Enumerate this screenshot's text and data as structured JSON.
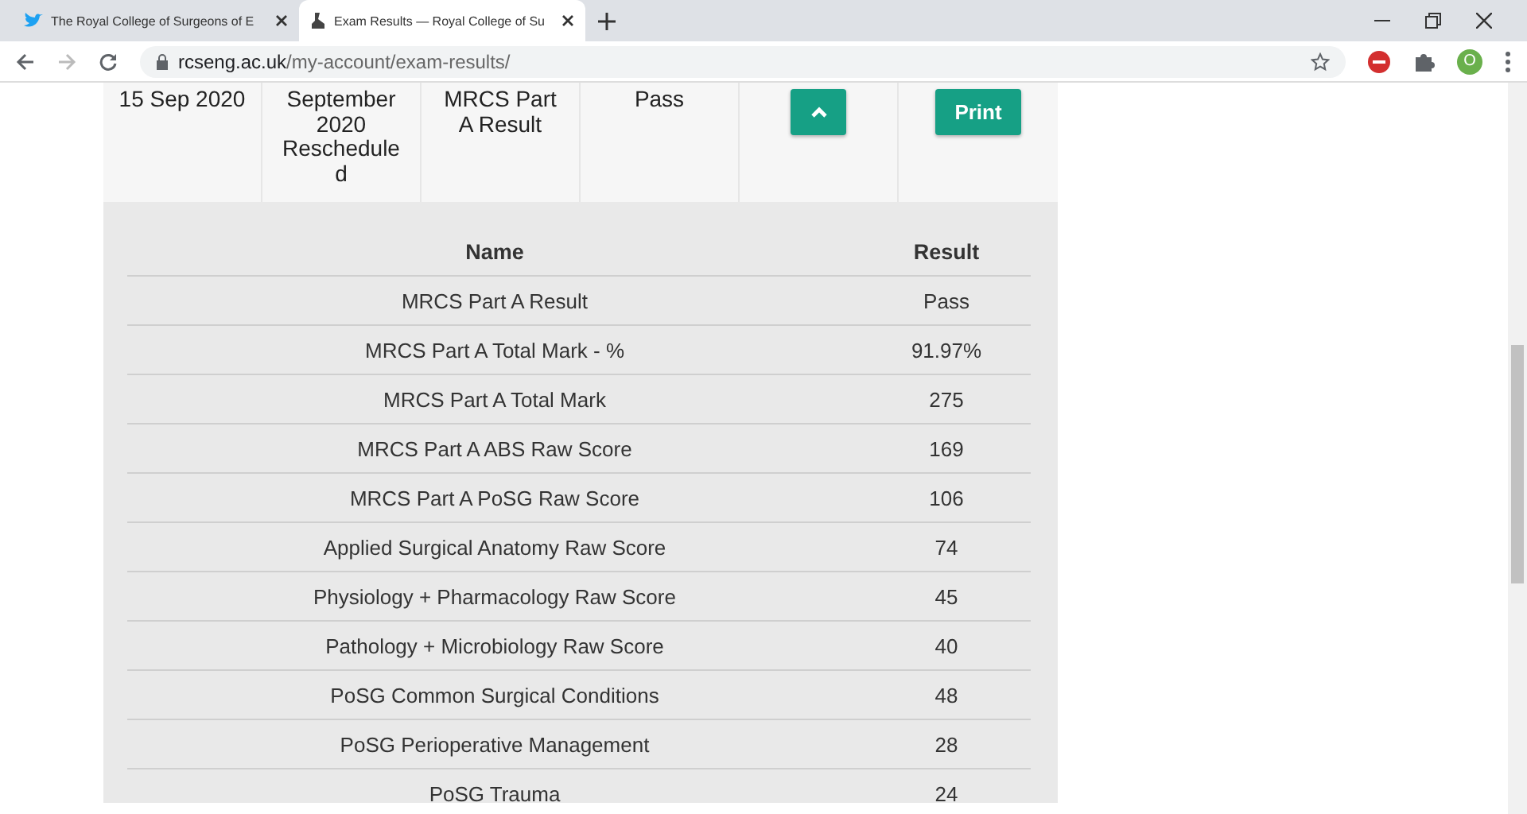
{
  "browser": {
    "tabs": [
      {
        "title": "The Royal College of Surgeons of E",
        "selected": false
      },
      {
        "title": "Exam Results — Royal College of Su",
        "selected": true
      }
    ],
    "address": {
      "host": "rcseng.ac.uk",
      "path": "/my-account/exam-results/"
    },
    "profile_initial": "O"
  },
  "exam_row": {
    "date": "15 Sep 2020",
    "session": "September 2020 Rescheduled",
    "exam": "MRCS Part A Result",
    "result": "Pass",
    "expanded": true,
    "print_button": "Print"
  },
  "details": {
    "columns": [
      "Name",
      "Result"
    ],
    "rows": [
      [
        "MRCS Part A Result",
        "Pass"
      ],
      [
        "MRCS Part A Total Mark - %",
        "91.97%"
      ],
      [
        "MRCS Part A Total Mark",
        "275"
      ],
      [
        "MRCS Part A ABS Raw Score",
        "169"
      ],
      [
        "MRCS Part A PoSG Raw Score",
        "106"
      ],
      [
        "Applied Surgical Anatomy Raw Score",
        "74"
      ],
      [
        "Physiology + Pharmacology Raw Score",
        "45"
      ],
      [
        "Pathology + Microbiology Raw Score",
        "40"
      ],
      [
        "PoSG Common Surgical Conditions",
        "48"
      ],
      [
        "PoSG Perioperative Management",
        "28"
      ],
      [
        "PoSG Trauma",
        "24"
      ]
    ]
  }
}
